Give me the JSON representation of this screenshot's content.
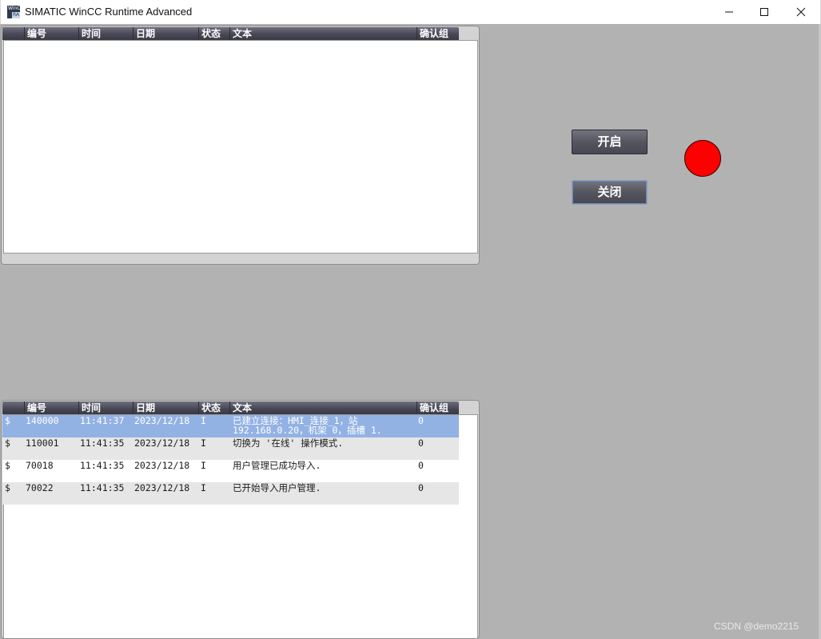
{
  "window": {
    "title": "SIMATIC WinCC Runtime Advanced",
    "icon_text_top": "WinCC",
    "icon_text_bottom": "RA",
    "controls": [
      "minimize-icon",
      "maximize-icon",
      "close-icon"
    ]
  },
  "alarm_columns": [
    "",
    "编号",
    "时间",
    "日期",
    "状态",
    "文本",
    "确认组"
  ],
  "top_alarm_view": {
    "rows": []
  },
  "bottom_alarm_view": {
    "rows": [
      {
        "flag": "$",
        "no": "140000",
        "time": "11:41:37",
        "date": "2023/12/18",
        "state": "I",
        "text": "已建立连接：HMI_连接_1，站 192.168.0.20，机架 0，插槽 1.",
        "group": "0"
      },
      {
        "flag": "$",
        "no": "110001",
        "time": "11:41:35",
        "date": "2023/12/18",
        "state": "I",
        "text": "切换为 '在线' 操作模式.",
        "group": "0"
      },
      {
        "flag": "$",
        "no": "70018",
        "time": "11:41:35",
        "date": "2023/12/18",
        "state": "I",
        "text": "用户管理已成功导入.",
        "group": "0"
      },
      {
        "flag": "$",
        "no": "70022",
        "time": "11:41:35",
        "date": "2023/12/18",
        "state": "I",
        "text": "已开始导入用户管理.",
        "group": "0"
      }
    ]
  },
  "buttons": {
    "open_label": "开启",
    "close_label": "关闭"
  },
  "indicator": {
    "color": "#ff0000"
  },
  "watermark": "CSDN @demo2215"
}
